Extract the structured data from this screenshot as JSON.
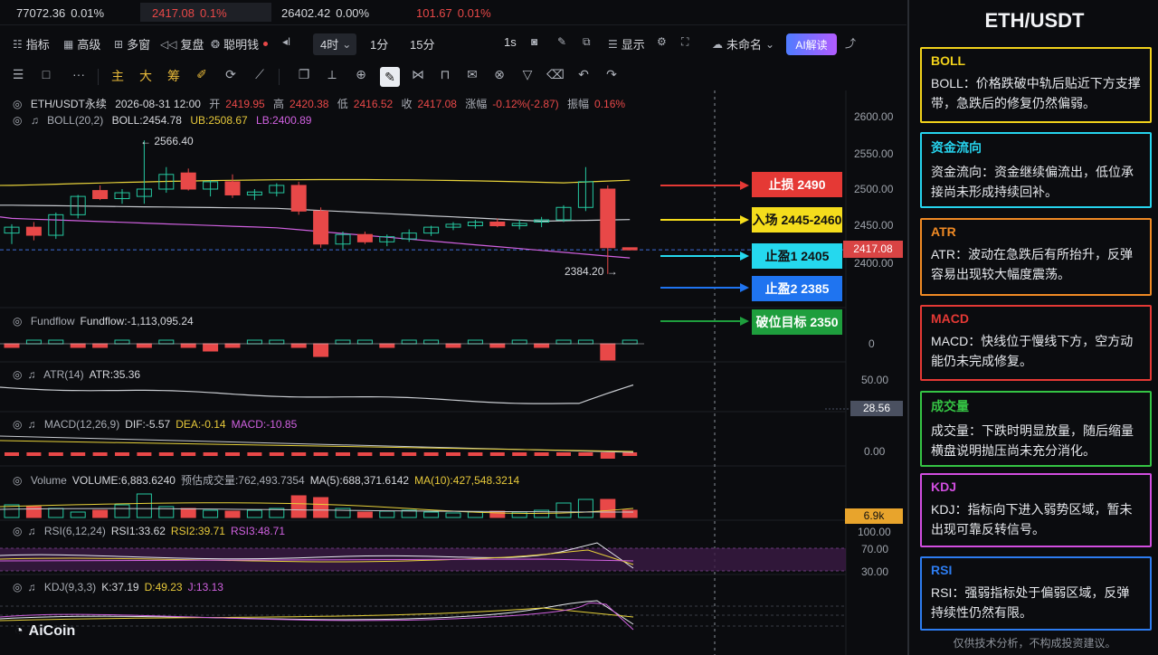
{
  "ticker": [
    {
      "price": "77072.36",
      "change": "0.01%",
      "color": "white"
    },
    {
      "price": "2417.08",
      "change": "0.1%",
      "color": "red"
    },
    {
      "price": "26402.42",
      "change": "0.00%",
      "color": "white"
    },
    {
      "price": "101.67",
      "change": "0.01%",
      "color": "red"
    }
  ],
  "toolbar": {
    "indicators": "指标",
    "advanced": "高级",
    "multi": "多窗",
    "replay": "复盘",
    "smart_money": "聪明钱",
    "timeframe": "4时",
    "tf_1m": "1分",
    "tf_15m": "15分",
    "interval_1s": "1s",
    "display": "显示",
    "layout_name": "未命名",
    "ai_label": "AI解读"
  },
  "drawing_tools": {
    "main": "主",
    "big": "大",
    "chip": "筹"
  },
  "header": {
    "symbol": "ETH/USDT永续",
    "datetime": "2026-08-31 12:00",
    "open_label": "开",
    "open": "2419.95",
    "high_label": "高",
    "high": "2420.38",
    "low_label": "低",
    "low": "2416.52",
    "close_label": "收",
    "close": "2417.08",
    "change_label": "涨幅",
    "change": "-0.12%(-2.87)",
    "amp_label": "振幅",
    "amp": "0.16%"
  },
  "boll": {
    "name": "BOLL(20,2)",
    "mid": "BOLL:2454.78",
    "ub": "UB:2508.67",
    "lb": "LB:2400.89"
  },
  "annotations": {
    "high": "← 2566.40",
    "low": "2384.20 →"
  },
  "price_axis": [
    "2600.00",
    "2550.00",
    "2500.00",
    "2450.00",
    "2400.00"
  ],
  "current_price": "2417.08",
  "levels": {
    "stop": "止损 2490",
    "entry": "入场 2445-2460",
    "tp1": "止盈1 2405",
    "tp2": "止盈2 2385",
    "break": "破位目标 2350"
  },
  "fundflow": {
    "name": "Fundflow",
    "value": "Fundflow:-1,113,095.24",
    "axis": "0"
  },
  "atr": {
    "name": "ATR(14)",
    "value": "ATR:35.36",
    "axis": "50.00",
    "tag": "28.56"
  },
  "macd": {
    "name": "MACD(12,26,9)",
    "dif": "DIF:-5.57",
    "dea": "DEA:-0.14",
    "macd": "MACD:-10.85",
    "axis": "0.00"
  },
  "volume": {
    "name": "Volume",
    "value": "VOLUME:6,883.6240",
    "est": "预估成交量:762,493.7354",
    "ma5": "MA(5):688,371.6142",
    "ma10": "MA(10):427,548.3214",
    "tag": "6.9k"
  },
  "rsi": {
    "name": "RSI(6,12,24)",
    "rsi1": "RSI1:33.62",
    "rsi2": "RSI2:39.71",
    "rsi3": "RSI3:48.71",
    "axis": [
      "100.00",
      "70.00",
      "30.00"
    ]
  },
  "kdj": {
    "name": "KDJ(9,3,3)",
    "k": "K:37.19",
    "d": "D:49.23",
    "j": "J:13.13"
  },
  "brand": "AiCoin",
  "panel": {
    "title": "ETH/USDT",
    "cards": [
      {
        "title": "BOLL",
        "color": "#f2d21b",
        "text": "BOLL：价格跌破中轨后贴近下方支撑带，急跌后的修复仍然偏弱。"
      },
      {
        "title": "资金流向",
        "color": "#26d4ee",
        "text": "资金流向：资金继续偏流出，低位承接尚未形成持续回补。"
      },
      {
        "title": "ATR",
        "color": "#f08a24",
        "text": "ATR：波动在急跌后有所抬升，反弹容易出现较大幅度震荡。"
      },
      {
        "title": "MACD",
        "color": "#e53935",
        "text": "MACD：快线位于慢线下方，空方动能仍未完成修复。"
      },
      {
        "title": "成交量",
        "color": "#35c444",
        "text": "成交量：下跌时明显放量，随后缩量横盘说明抛压尚未充分消化。"
      },
      {
        "title": "KDJ",
        "color": "#d24ee0",
        "text": "KDJ：指标向下进入弱势区域，暂未出现可靠反转信号。"
      },
      {
        "title": "RSI",
        "color": "#2d7cf0",
        "text": "RSI：强弱指标处于偏弱区域，反弹持续性仍然有限。"
      }
    ],
    "disclaimer": "仅供技术分析，不构成投资建议。"
  },
  "colors": {
    "up": "#25c8a0",
    "down": "#e84848",
    "ub": "#e7d23a",
    "mid": "#c8cbd0",
    "lb": "#d061e0"
  },
  "chart_data": {
    "type": "candlestick",
    "candles": [
      [
        2440,
        2452,
        2425,
        2448
      ],
      [
        2448,
        2455,
        2430,
        2437
      ],
      [
        2437,
        2468,
        2432,
        2465
      ],
      [
        2465,
        2492,
        2460,
        2490
      ],
      [
        2498,
        2505,
        2485,
        2487
      ],
      [
        2487,
        2500,
        2480,
        2495
      ],
      [
        2490,
        2566.4,
        2480,
        2500
      ],
      [
        2500,
        2530,
        2495,
        2520
      ],
      [
        2522,
        2528,
        2498,
        2500
      ],
      [
        2500,
        2512,
        2490,
        2510
      ],
      [
        2510,
        2520,
        2488,
        2492
      ],
      [
        2492,
        2500,
        2485,
        2496
      ],
      [
        2495,
        2508,
        2490,
        2505
      ],
      [
        2505,
        2510,
        2465,
        2470
      ],
      [
        2470,
        2475,
        2420,
        2425
      ],
      [
        2425,
        2442,
        2418,
        2438
      ],
      [
        2438,
        2442,
        2425,
        2428
      ],
      [
        2428,
        2438,
        2422,
        2435
      ],
      [
        2432,
        2445,
        2428,
        2440
      ],
      [
        2440,
        2450,
        2436,
        2448
      ],
      [
        2448,
        2455,
        2444,
        2452
      ],
      [
        2450,
        2458,
        2446,
        2455
      ],
      [
        2455,
        2460,
        2448,
        2450
      ],
      [
        2450,
        2458,
        2445,
        2453
      ],
      [
        2455,
        2462,
        2448,
        2458
      ],
      [
        2458,
        2478,
        2455,
        2475
      ],
      [
        2475,
        2530,
        2470,
        2510
      ],
      [
        2500,
        2505,
        2384.2,
        2420
      ],
      [
        2419.95,
        2420.38,
        2416.52,
        2417.08
      ]
    ]
  }
}
